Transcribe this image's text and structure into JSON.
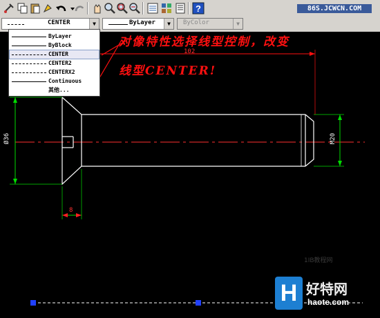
{
  "toolbar": {
    "icons": [
      "match-properties-icon",
      "copy-icon",
      "paste-icon",
      "paint-icon",
      "undo-icon",
      "dropdown-arrow-icon",
      "redo-icon",
      "pan-icon",
      "zoom-realtime-icon",
      "zoom-window-icon",
      "zoom-previous-icon",
      "properties-icon",
      "design-center-icon",
      "tool-palettes-icon",
      "help-icon"
    ],
    "site_badge": "86S.JCWCN.COM"
  },
  "properties_bar": {
    "linetype_value": "CENTER",
    "lineweight_value": "ByLayer",
    "plotstyle_value": "ByColor"
  },
  "linetype_dropdown": {
    "items": [
      {
        "label": "ByLayer",
        "style": "solid"
      },
      {
        "label": "ByBlock",
        "style": "solid"
      },
      {
        "label": "CENTER",
        "style": "center",
        "selected": true
      },
      {
        "label": "CENTER2",
        "style": "center"
      },
      {
        "label": "CENTERX2",
        "style": "center"
      },
      {
        "label": "Continuous",
        "style": "solid"
      },
      {
        "label": "其他...",
        "style": "none"
      }
    ]
  },
  "annotation": {
    "line1": "对像特性选择线型控制，改变",
    "line2": "线型CENTER!"
  },
  "dimensions": {
    "length": "102",
    "diameter": "Ø36",
    "thread": "M20",
    "head": "8"
  },
  "watermark": "1IB教程网",
  "logo": {
    "glyph": "H",
    "text_cn": "好特网",
    "url": "haote.com"
  },
  "colors": {
    "toolbar_bg": "#d6d3ce",
    "canvas_bg": "#000000",
    "annotation": "#ff1010",
    "dimension": "#00dd00",
    "centerline": "#ff3030",
    "geometry": "#ffffff",
    "grip": "#2040ff"
  }
}
